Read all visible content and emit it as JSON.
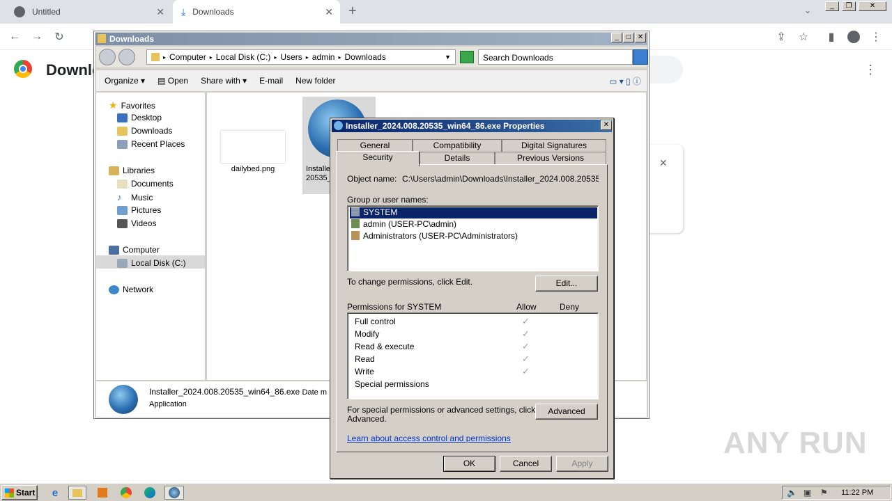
{
  "browser": {
    "tabs": [
      {
        "label": "Untitled"
      },
      {
        "label": "Downloads"
      }
    ],
    "page_heading": "Downle"
  },
  "explorer": {
    "title": "Downloads",
    "breadcrumb": [
      "Computer",
      "Local Disk (C:)",
      "Users",
      "admin",
      "Downloads"
    ],
    "search_placeholder": "Search Downloads",
    "commands": [
      "Organize",
      "Open",
      "Share with",
      "E-mail",
      "New folder"
    ],
    "nav": {
      "favorites": "Favorites",
      "desktop": "Desktop",
      "downloads": "Downloads",
      "recent": "Recent Places",
      "libraries": "Libraries",
      "documents": "Documents",
      "music": "Music",
      "pictures": "Pictures",
      "videos": "Videos",
      "computer": "Computer",
      "local_disk": "Local Disk (C:)",
      "network": "Network"
    },
    "files": [
      {
        "name": "dailybed.png"
      },
      {
        "name": "Installe",
        "name2": "20535_"
      }
    ],
    "status": {
      "filename": "Installer_2024.008.20535_win64_86.exe",
      "extra": "Date m",
      "type": "Application"
    }
  },
  "properties": {
    "title": "Installer_2024.008.20535_win64_86.exe Properties",
    "tabs_row1": [
      "General",
      "Compatibility",
      "Digital Signatures"
    ],
    "tabs_row2": [
      "Security",
      "Details",
      "Previous Versions"
    ],
    "object_label": "Object name:",
    "object_value": "C:\\Users\\admin\\Downloads\\Installer_2024.008.20535_win",
    "group_label": "Group or user names:",
    "users": [
      "SYSTEM",
      "admin (USER-PC\\admin)",
      "Administrators (USER-PC\\Administrators)"
    ],
    "change_text": "To change permissions, click Edit.",
    "edit_button": "Edit...",
    "perm_label": "Permissions for SYSTEM",
    "allow": "Allow",
    "deny": "Deny",
    "permissions": [
      {
        "name": "Full control",
        "allow": true
      },
      {
        "name": "Modify",
        "allow": true
      },
      {
        "name": "Read & execute",
        "allow": true
      },
      {
        "name": "Read",
        "allow": true
      },
      {
        "name": "Write",
        "allow": true
      },
      {
        "name": "Special permissions",
        "allow": false
      }
    ],
    "special_text_1": "For special permissions or advanced settings, click",
    "special_text_2": "Advanced.",
    "advanced_button": "Advanced",
    "learn_link": "Learn about access control and permissions",
    "ok": "OK",
    "cancel": "Cancel",
    "apply": "Apply"
  },
  "taskbar": {
    "start": "Start",
    "clock": "11:22 PM"
  },
  "watermark": "ANY RUN"
}
